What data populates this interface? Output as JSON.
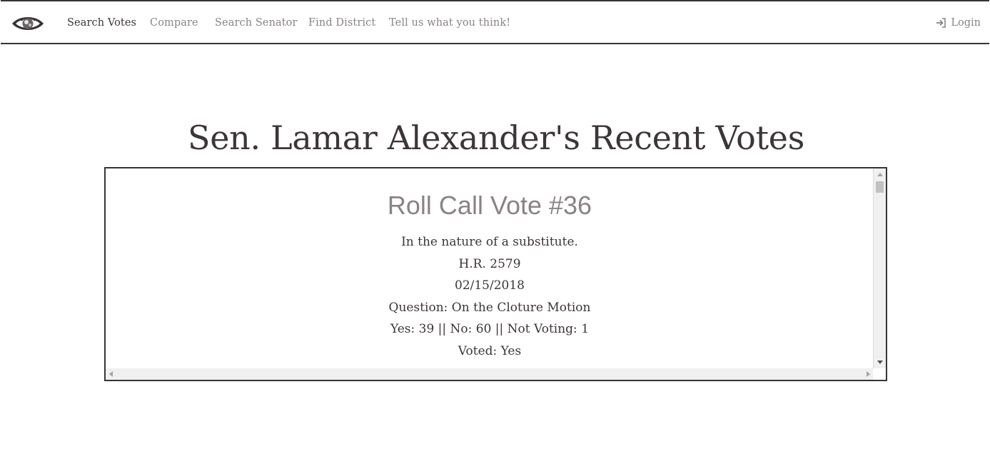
{
  "nav": {
    "logo_icon": "eye-logo-icon",
    "items": [
      {
        "label": "Search Votes",
        "active": true
      },
      {
        "label": "Compare",
        "active": false
      },
      {
        "label": "Search Senator",
        "active": false
      },
      {
        "label": "Find District",
        "active": false
      },
      {
        "label": "Tell us what you think!",
        "active": false
      }
    ],
    "login": {
      "label": "Login",
      "icon": "sign-in-icon"
    }
  },
  "page": {
    "title": "Sen. Lamar Alexander's Recent Votes"
  },
  "vote": {
    "heading": "Roll Call Vote #36",
    "description": "In the nature of a substitute.",
    "bill": "H.R. 2579",
    "date": "02/15/2018",
    "question": "Question: On the Cloture Motion",
    "tally": "Yes: 39 || No: 60 || Not Voting: 1",
    "voted": "Voted: Yes"
  },
  "colors": {
    "text_dark": "#3d3537",
    "text_muted": "#8a8385",
    "border": "#3a3335"
  }
}
